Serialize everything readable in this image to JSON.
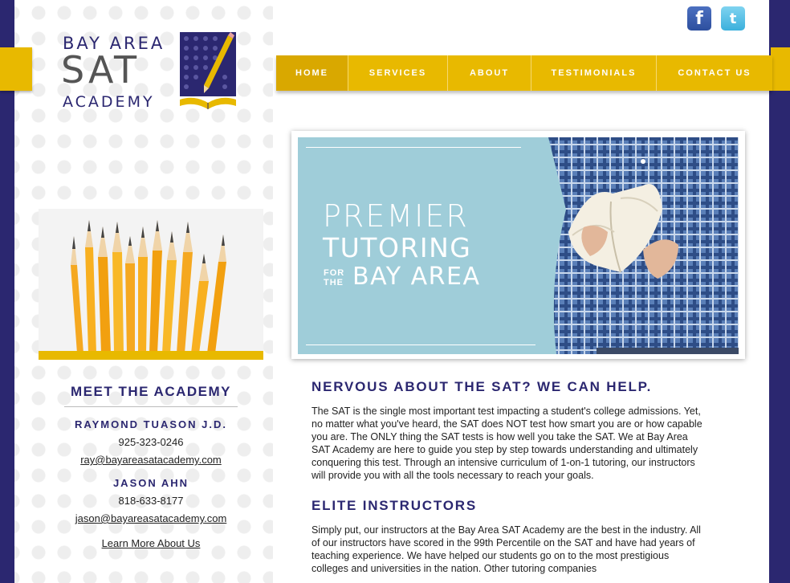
{
  "brand": {
    "line1": "BAY AREA",
    "line2": "SAT",
    "line3": "ACADEMY",
    "colors": {
      "navy": "#2b2770",
      "gold": "#e8b900",
      "sky": "#9fcdd9"
    }
  },
  "social": {
    "facebook": {
      "icon": "facebook-icon",
      "glyph": "f"
    },
    "twitter": {
      "icon": "twitter-icon",
      "glyph": "t"
    }
  },
  "nav": {
    "items": [
      {
        "label": "HOME",
        "active": true
      },
      {
        "label": "SERVICES"
      },
      {
        "label": "ABOUT"
      },
      {
        "label": "TESTIMONIALS"
      },
      {
        "label": "CONTACT US"
      }
    ]
  },
  "hero": {
    "line1": "PREMIER",
    "line2": "TUTORING",
    "small_for": "FOR",
    "small_the": "THE",
    "line3": "BAY AREA"
  },
  "sidebar": {
    "title": "MEET THE ACADEMY",
    "people": [
      {
        "name": "RAYMOND TUASON J.D.",
        "phone": "925-323-0246",
        "email": "ray@bayareasatacademy.com"
      },
      {
        "name": "JASON AHN",
        "phone": "818-633-8177",
        "email": "jason@bayareasatacademy.com"
      }
    ],
    "learn_more": "Learn More About Us"
  },
  "main": {
    "heading1": "NERVOUS ABOUT THE SAT? WE CAN HELP.",
    "para1": "The SAT is the single most important test impacting a student's college admissions. Yet, no matter what you've heard, the SAT does NOT test how smart you are or how capable you are. The ONLY thing the SAT tests is how well you take the SAT. We at Bay Area SAT Academy are here to guide you step by step towards understanding and ultimately conquering this test. Through an intensive curriculum of 1-on-1 tutoring, our instructors will provide you with all the tools necessary to reach your goals.",
    "heading2": "ELITE INSTRUCTORS",
    "para2": "Simply put, our instructors at the Bay Area SAT Academy are the best in the industry. All of our instructors have scored in the 99th Percentile on the SAT and have had years of teaching experience. We have helped our students go on to the most prestigious colleges and universities in the nation. Other tutoring companies"
  }
}
